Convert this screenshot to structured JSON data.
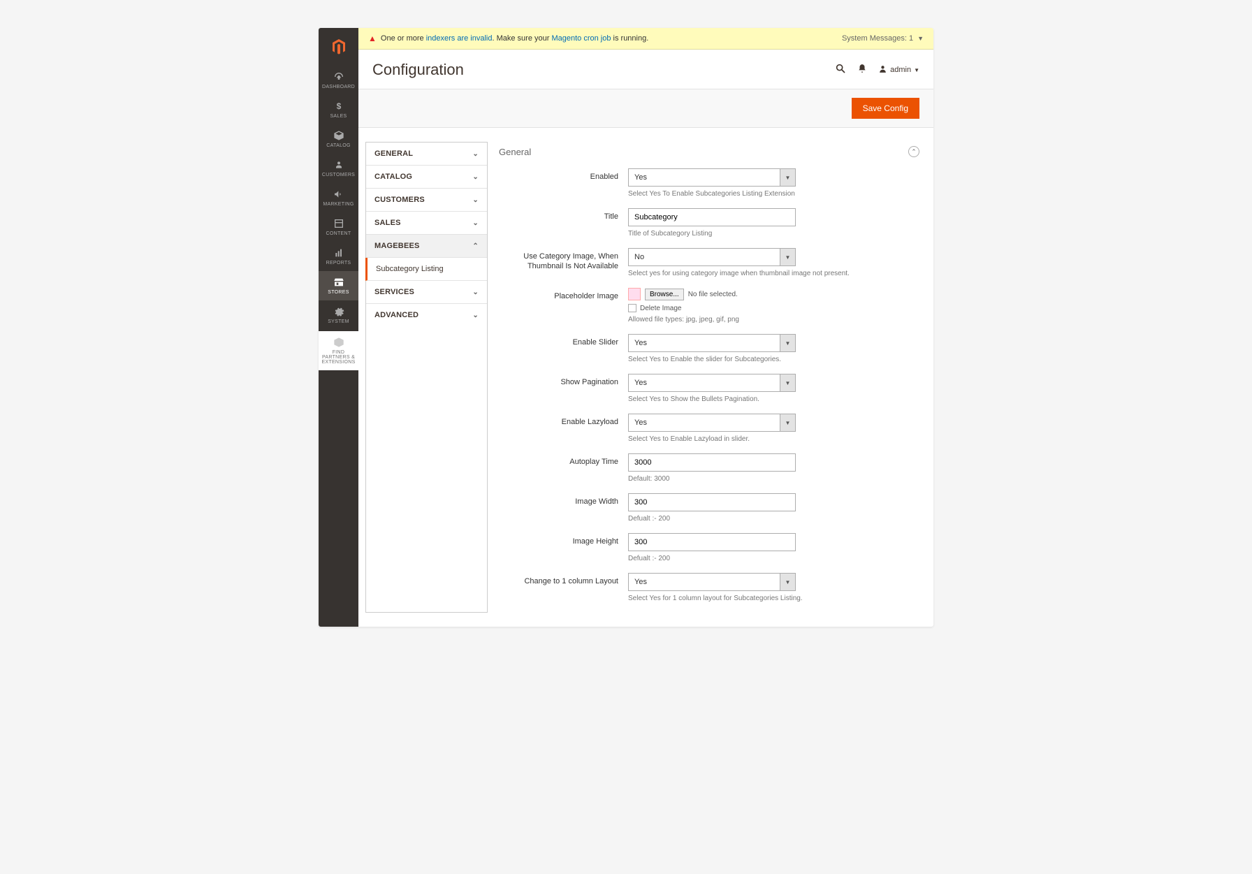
{
  "sysmsg": {
    "prefix": "One or more ",
    "link1": "indexers are invalid",
    "mid": ". Make sure your ",
    "link2": "Magento cron job",
    "suffix": " is running.",
    "count_label": "System Messages:",
    "count": "1"
  },
  "header": {
    "title": "Configuration",
    "admin_label": "admin"
  },
  "actionbar": {
    "save": "Save Config"
  },
  "sidebar": {
    "items": [
      {
        "label": "DASHBOARD"
      },
      {
        "label": "SALES"
      },
      {
        "label": "CATALOG"
      },
      {
        "label": "CUSTOMERS"
      },
      {
        "label": "MARKETING"
      },
      {
        "label": "CONTENT"
      },
      {
        "label": "REPORTS"
      },
      {
        "label": "STORES"
      },
      {
        "label": "SYSTEM"
      },
      {
        "label": "FIND PARTNERS & EXTENSIONS"
      }
    ]
  },
  "config_nav": {
    "items": [
      {
        "label": "GENERAL"
      },
      {
        "label": "CATALOG"
      },
      {
        "label": "CUSTOMERS"
      },
      {
        "label": "SALES"
      },
      {
        "label": "MAGEBEES"
      },
      {
        "label": "SERVICES"
      },
      {
        "label": "ADVANCED"
      }
    ],
    "sub": "Subcategory Listing"
  },
  "section": {
    "title": "General"
  },
  "fields": {
    "enabled": {
      "label": "Enabled",
      "value": "Yes",
      "hint": "Select Yes To Enable Subcategories Listing Extension"
    },
    "title": {
      "label": "Title",
      "value": "Subcategory",
      "hint": "Title of Subcategory Listing"
    },
    "catimg": {
      "label": "Use Category Image, When Thumbnail Is Not Available",
      "value": "No",
      "hint": "Select yes for using category image when thumbnail image not present."
    },
    "placeholder": {
      "label": "Placeholder Image",
      "browse": "Browse...",
      "nofile": "No file selected.",
      "delete": "Delete Image",
      "hint": "Allowed file types: jpg, jpeg, gif, png"
    },
    "slider": {
      "label": "Enable Slider",
      "value": "Yes",
      "hint": "Select Yes to Enable the slider for Subcategories."
    },
    "pagination": {
      "label": "Show Pagination",
      "value": "Yes",
      "hint": "Select Yes to Show the Bullets Pagination."
    },
    "lazyload": {
      "label": "Enable Lazyload",
      "value": "Yes",
      "hint": "Select Yes to Enable Lazyload in slider."
    },
    "autoplay": {
      "label": "Autoplay Time",
      "value": "3000",
      "hint": "Default: 3000"
    },
    "width": {
      "label": "Image Width",
      "value": "300",
      "hint": "Defualt :- 200"
    },
    "height": {
      "label": "Image Height",
      "value": "300",
      "hint": "Defualt :- 200"
    },
    "layout": {
      "label": "Change to 1 column Layout",
      "value": "Yes",
      "hint": "Select Yes for 1 column layout for Subcategories Listing."
    }
  }
}
